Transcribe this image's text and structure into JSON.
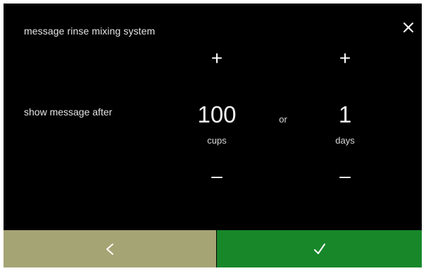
{
  "screen": {
    "title": "message rinse mixing system"
  },
  "setting": {
    "label": "show message after",
    "cups": {
      "value": "100",
      "unit": "cups"
    },
    "separator": "or",
    "days": {
      "value": "1",
      "unit": "days"
    }
  },
  "glyphs": {
    "plus": "+",
    "minus": "–"
  },
  "icons": {
    "close": "close-icon",
    "back": "chevron-left-icon",
    "confirm": "checkmark-icon"
  },
  "colors": {
    "screen_background": "#000000",
    "back_button": "#a5a474",
    "confirm_button": "#17872a",
    "text": "#ffffff"
  }
}
